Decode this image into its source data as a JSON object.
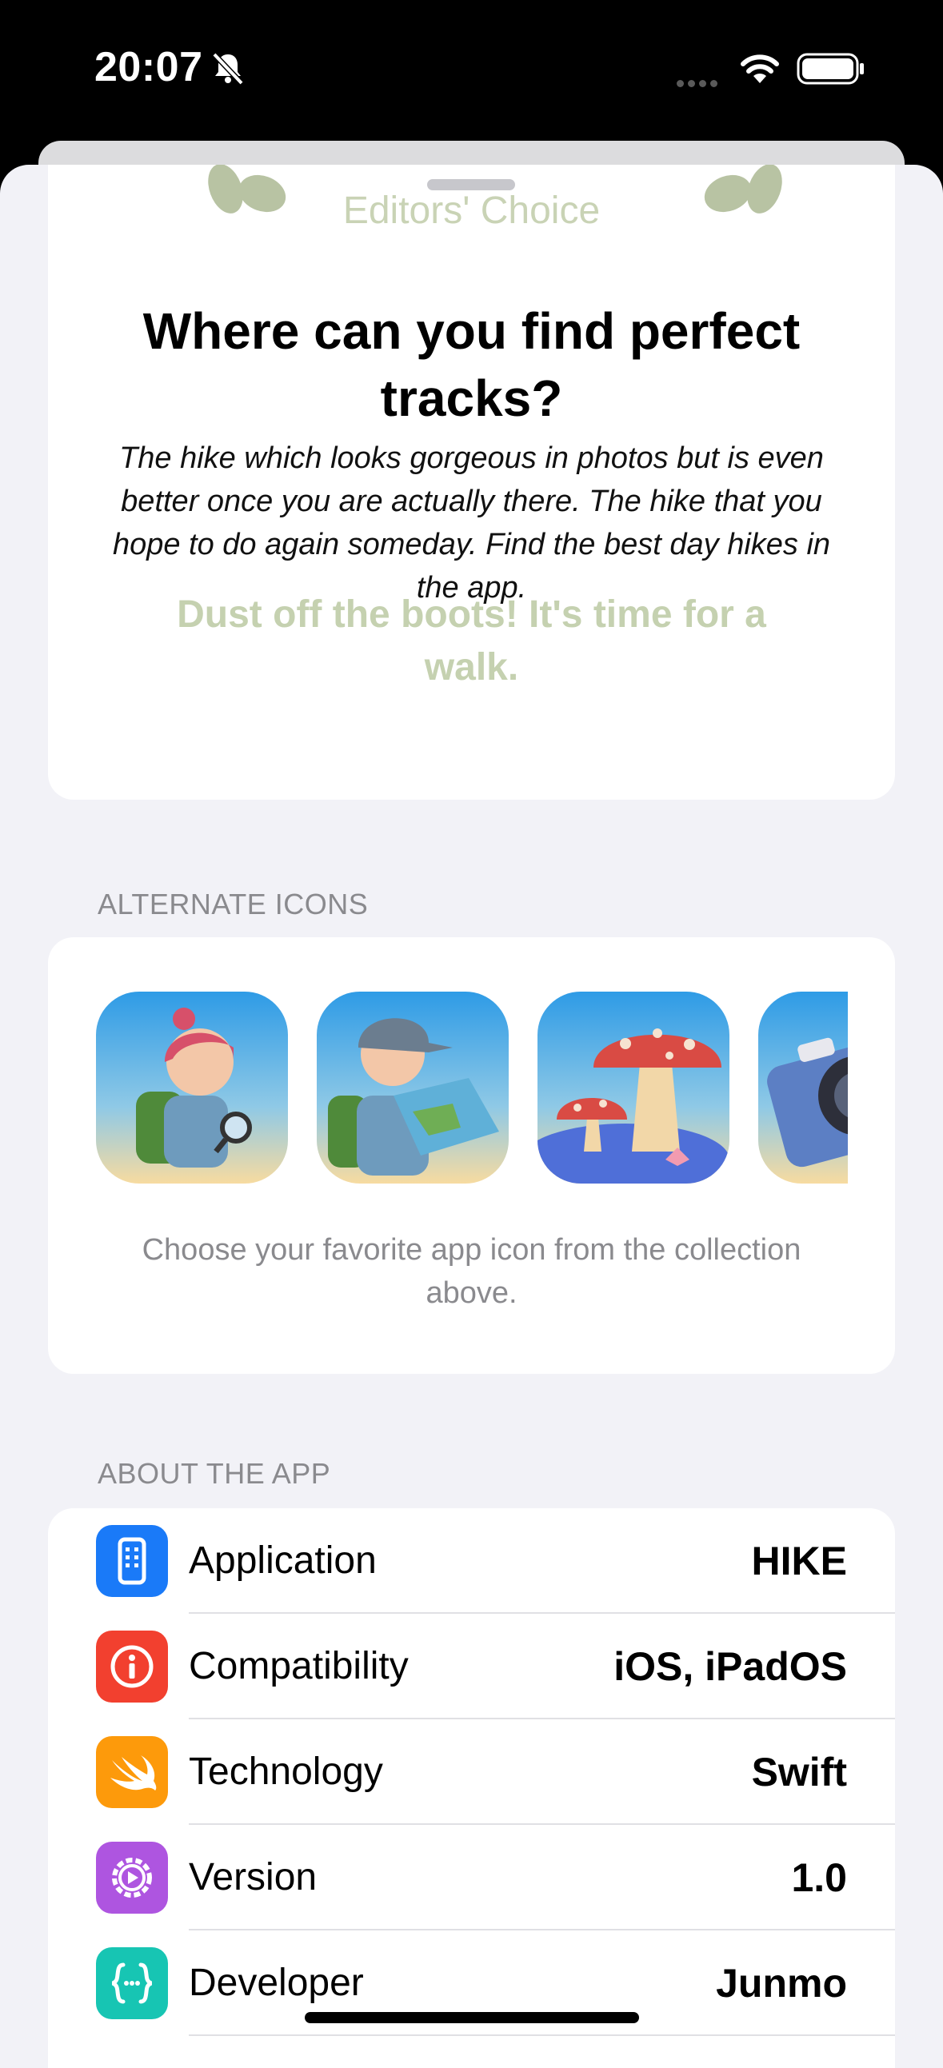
{
  "status_bar": {
    "time": "20:07"
  },
  "hero": {
    "badge": "Editors' Choice",
    "title": "Where can you find perfect tracks?",
    "body": "The hike which looks gorgeous in photos but is even better once you are actually there. The hike that you hope to do again someday. Find the best day hikes in the app.",
    "tagline": "Dust off the boots! It's time for a walk."
  },
  "alternate_icons": {
    "header": "ALTERNATE ICONS",
    "caption": "Choose your favorite app icon from the collection above.",
    "icons": [
      "hiker-girl-magnifier-icon",
      "hiker-boy-map-icon",
      "mushroom-icon",
      "camera-icon"
    ]
  },
  "about": {
    "header": "ABOUT THE APP",
    "rows": [
      {
        "label": "Application",
        "value": "HIKE",
        "color": "#1a7af8"
      },
      {
        "label": "Compatibility",
        "value": "iOS, iPadOS",
        "color": "#f2402f"
      },
      {
        "label": "Technology",
        "value": "Swift",
        "color": "#fd9a0b"
      },
      {
        "label": "Version",
        "value": "1.0",
        "color": "#ae55e0"
      },
      {
        "label": "Developer",
        "value": "Junmo",
        "color": "#17c5b3"
      }
    ]
  }
}
